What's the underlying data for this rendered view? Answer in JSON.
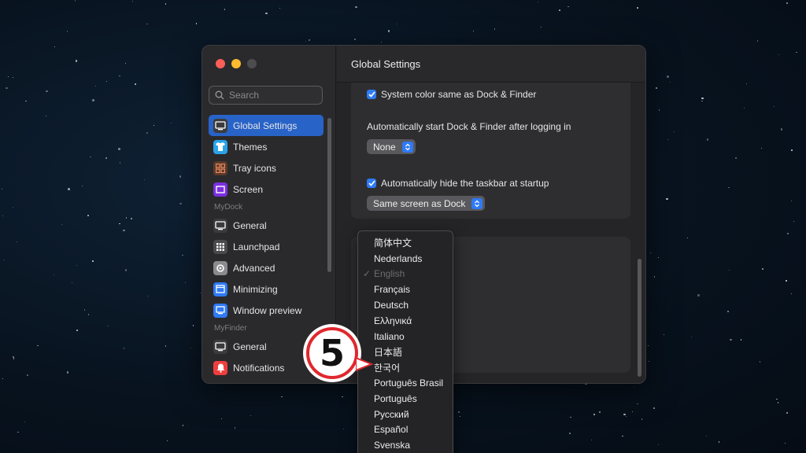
{
  "colors": {
    "accent": "#2863c8",
    "checkbox": "#2f7af5",
    "badge_ring": "#e0282e"
  },
  "sidebar": {
    "search_placeholder": "Search",
    "items": [
      {
        "label": "Global Settings",
        "icon": "monitor-icon",
        "active": true
      },
      {
        "label": "Themes",
        "icon": "tshirt-icon"
      },
      {
        "label": "Tray icons",
        "icon": "grid-icon"
      },
      {
        "label": "Screen",
        "icon": "screen-icon"
      }
    ],
    "mydock_label": "MyDock",
    "mydock_items": [
      {
        "label": "General",
        "icon": "monitor-icon"
      },
      {
        "label": "Launchpad",
        "icon": "launchpad-icon"
      },
      {
        "label": "Advanced",
        "icon": "gear-icon"
      },
      {
        "label": "Minimizing",
        "icon": "window-icon"
      },
      {
        "label": "Window preview",
        "icon": "preview-icon"
      }
    ],
    "myfinder_label": "MyFinder",
    "myfinder_items": [
      {
        "label": "General",
        "icon": "monitor-icon"
      },
      {
        "label": "Notifications",
        "icon": "bell-icon"
      }
    ]
  },
  "main": {
    "title": "Global Settings",
    "system_color_label": "System color same as Dock & Finder",
    "auto_start_label": "Automatically start Dock & Finder after logging in",
    "auto_start_value": "None",
    "auto_hide_label": "Automatically hide the taskbar at startup",
    "screen_value": "Same screen as Dock"
  },
  "language_menu": {
    "items": [
      "简体中文",
      "Nederlands",
      "English",
      "Français",
      "Deutsch",
      "Ελληνικά",
      "Italiano",
      "日本語",
      "한국어",
      "Português Brasil",
      "Português",
      "Русский",
      "Español",
      "Svenska"
    ],
    "selected": "English"
  },
  "annotation": {
    "step": "5"
  }
}
